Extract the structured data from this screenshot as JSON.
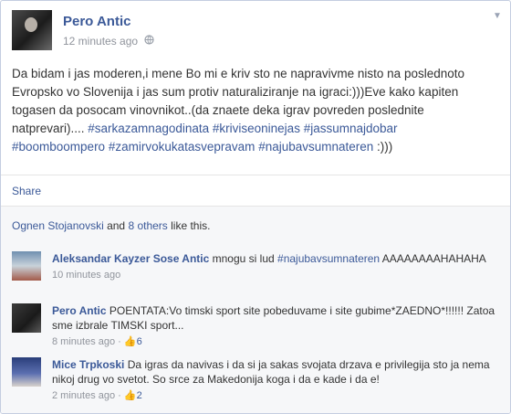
{
  "post": {
    "author": "Pero Antic",
    "time": "12 minutes ago",
    "text_segments": [
      {
        "text": "Da bidam i jas moderen,i mene Bo mi e kriv sto ne napravivme nisto na poslednoto Evropsko vo Slovenija i jas sum protiv naturaliziranje na igraci:)))Eve kako kapiten togasen da posocam vinovnikot..(da znaete deka igrav povreden poslednite natprevari).... ",
        "tag": false
      },
      {
        "text": "#sarkazamnagodinata",
        "tag": true
      },
      {
        "text": " ",
        "tag": false
      },
      {
        "text": "#kriviseoninejas",
        "tag": true
      },
      {
        "text": " ",
        "tag": false
      },
      {
        "text": "#jassumnajdobar",
        "tag": true
      },
      {
        "text": " ",
        "tag": false
      },
      {
        "text": "#boomboompero",
        "tag": true
      },
      {
        "text": " ",
        "tag": false
      },
      {
        "text": "#zamirvokukatasvepravam",
        "tag": true
      },
      {
        "text": " ",
        "tag": false
      },
      {
        "text": "#najubavsumnateren",
        "tag": true
      },
      {
        "text": " :)))",
        "tag": false
      }
    ]
  },
  "actions": {
    "share_label": "Share"
  },
  "likes": {
    "names": "Ognen Stojanovski",
    "connector": " and ",
    "others": "8 others",
    "suffix": " like this."
  },
  "comments": [
    {
      "author": "Aleksandar Kayzer Sose Antic",
      "segments": [
        {
          "text": " mnogu si lud ",
          "tag": false
        },
        {
          "text": "#najubavsumnateren",
          "tag": true
        },
        {
          "text": " AAAAAAAAHAHAHA",
          "tag": false
        }
      ],
      "time": "10 minutes ago",
      "likes": ""
    },
    {
      "author": "Pero Antic",
      "segments": [
        {
          "text": " POENTATA:Vo timski sport site pobeduvame i site gubime*ZAEDNO*!!!!!! Zatoa sme izbrale TIMSKI sport...",
          "tag": false
        }
      ],
      "time": "8 minutes ago",
      "likes": "6"
    },
    {
      "author": "Mice Trpkoski",
      "segments": [
        {
          "text": " Da igras da navivas i da si ja sakas svojata drzava e privilegija sto ja nema nikoj drug vo svetot. So srce za Makedonija koga i da e kade i da e!",
          "tag": false
        }
      ],
      "time": "2 minutes ago",
      "likes": "2"
    }
  ]
}
